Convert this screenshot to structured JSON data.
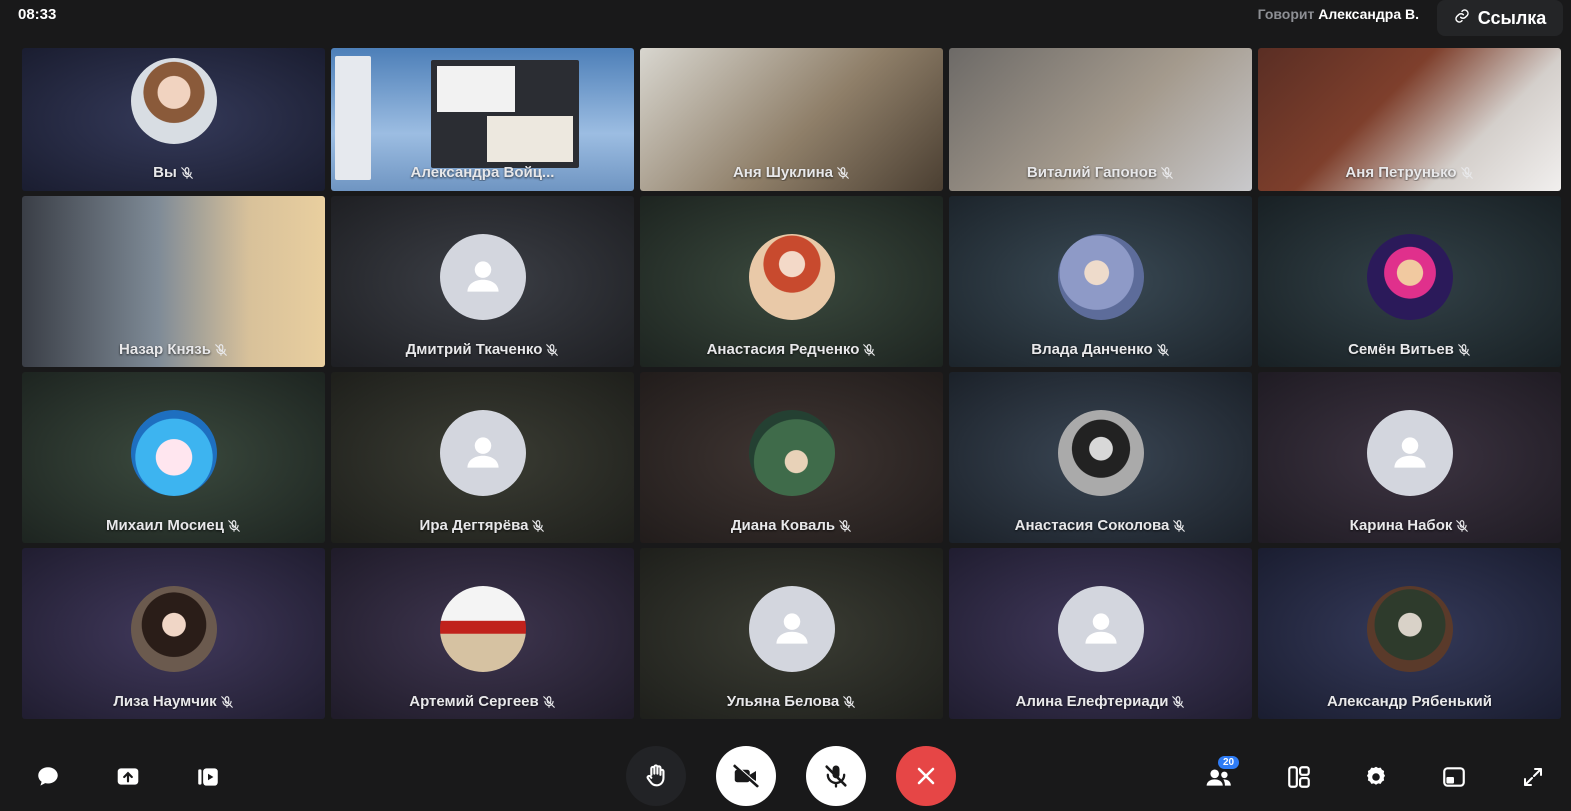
{
  "header": {
    "time": "08:33",
    "speaking_label": "Говорит",
    "speaker_name": "Александра В.",
    "link_label": "Ссылка"
  },
  "participants": [
    {
      "name": "Вы",
      "kind": "avatar-photo"
    },
    {
      "name": "Александра Войц...",
      "kind": "video"
    },
    {
      "name": "Аня Шуклина",
      "kind": "video"
    },
    {
      "name": "Виталий Гапонов",
      "kind": "video"
    },
    {
      "name": "Аня Петрунько",
      "kind": "video"
    },
    {
      "name": "Назар Князь",
      "kind": "video"
    },
    {
      "name": "Дмитрий Ткаченко",
      "kind": "placeholder"
    },
    {
      "name": "Анастасия Редченко",
      "kind": "avatar-photo"
    },
    {
      "name": "Влада Данченко",
      "kind": "avatar-photo"
    },
    {
      "name": "Семён Витьев",
      "kind": "avatar-photo"
    },
    {
      "name": "Михаил Мосиец",
      "kind": "avatar-photo"
    },
    {
      "name": "Ира Дегтярёва",
      "kind": "placeholder"
    },
    {
      "name": "Диана Коваль",
      "kind": "avatar-photo"
    },
    {
      "name": "Анастасия Соколова",
      "kind": "avatar-photo"
    },
    {
      "name": "Карина Набок",
      "kind": "placeholder"
    },
    {
      "name": "Лиза Наумчик",
      "kind": "avatar-photo"
    },
    {
      "name": "Артемий Сергеев",
      "kind": "avatar-photo"
    },
    {
      "name": "Ульяна Белова",
      "kind": "placeholder"
    },
    {
      "name": "Алина Елефтериади",
      "kind": "placeholder"
    },
    {
      "name": "Александр Рябенький",
      "kind": "avatar-photo"
    }
  ],
  "controls": {
    "participants_count": "20"
  },
  "colors": {
    "background": "#19191a",
    "end_call": "#e64646",
    "badge": "#2e7cf6"
  }
}
